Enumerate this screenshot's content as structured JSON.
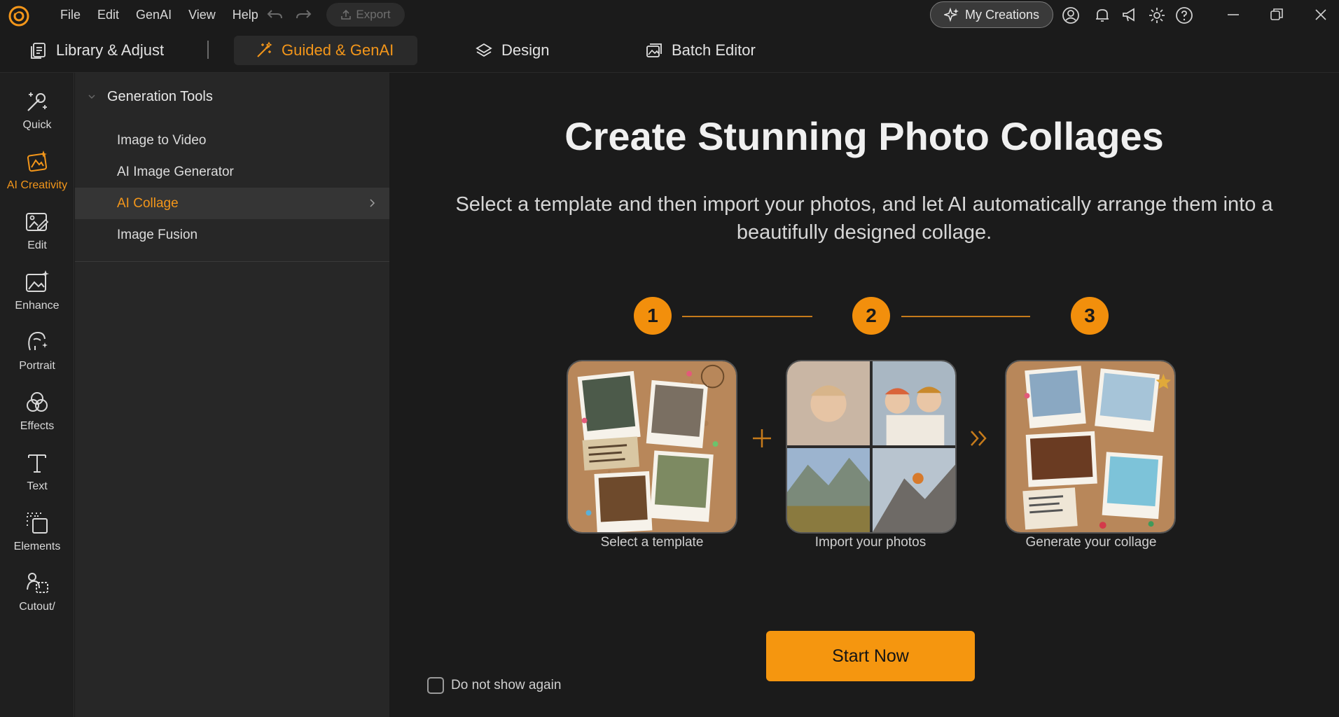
{
  "menu": {
    "items": [
      "File",
      "Edit",
      "GenAI",
      "View",
      "Help"
    ]
  },
  "toolbar": {
    "export_label": "Export",
    "my_creations_label": "My Creations"
  },
  "mode_tabs": [
    {
      "label": "Library & Adjust",
      "icon": "library-icon"
    },
    {
      "label": "Guided & GenAI",
      "icon": "magic-wand-icon",
      "active": true
    },
    {
      "label": "Design",
      "icon": "layers-icon"
    },
    {
      "label": "Batch Editor",
      "icon": "images-icon"
    }
  ],
  "rail": {
    "items": [
      {
        "label": "Quick",
        "icon": "magic-sparkle-icon"
      },
      {
        "label": "AI Creativity",
        "icon": "ai-creativity-icon",
        "active": true
      },
      {
        "label": "Edit",
        "icon": "edit-image-icon"
      },
      {
        "label": "Enhance",
        "icon": "enhance-icon"
      },
      {
        "label": "Portrait",
        "icon": "portrait-icon"
      },
      {
        "label": "Effects",
        "icon": "effects-icon"
      },
      {
        "label": "Text",
        "icon": "text-icon"
      },
      {
        "label": "Elements",
        "icon": "elements-icon"
      },
      {
        "label": "Cutout/",
        "icon": "cutout-icon"
      }
    ]
  },
  "subpanel": {
    "header": "Generation Tools",
    "items": [
      {
        "label": "Image to Video"
      },
      {
        "label": "AI Image Generator"
      },
      {
        "label": "AI Collage",
        "active": true
      },
      {
        "label": "Image Fusion"
      }
    ]
  },
  "main": {
    "title": "Create Stunning Photo Collages",
    "subtitle": "Select a template and then import your photos, and let AI automatically arrange them into a beautifully designed collage.",
    "steps": [
      {
        "number": "1",
        "label": "Select a template"
      },
      {
        "number": "2",
        "label": "Import your photos"
      },
      {
        "number": "3",
        "label": "Generate your collage"
      }
    ],
    "start_label": "Start Now",
    "do_not_show_label": "Do not show again"
  },
  "colors": {
    "accent": "#f3961a",
    "background": "#1b1b1b",
    "panel": "#272727",
    "rail": "#1f1f1f"
  }
}
